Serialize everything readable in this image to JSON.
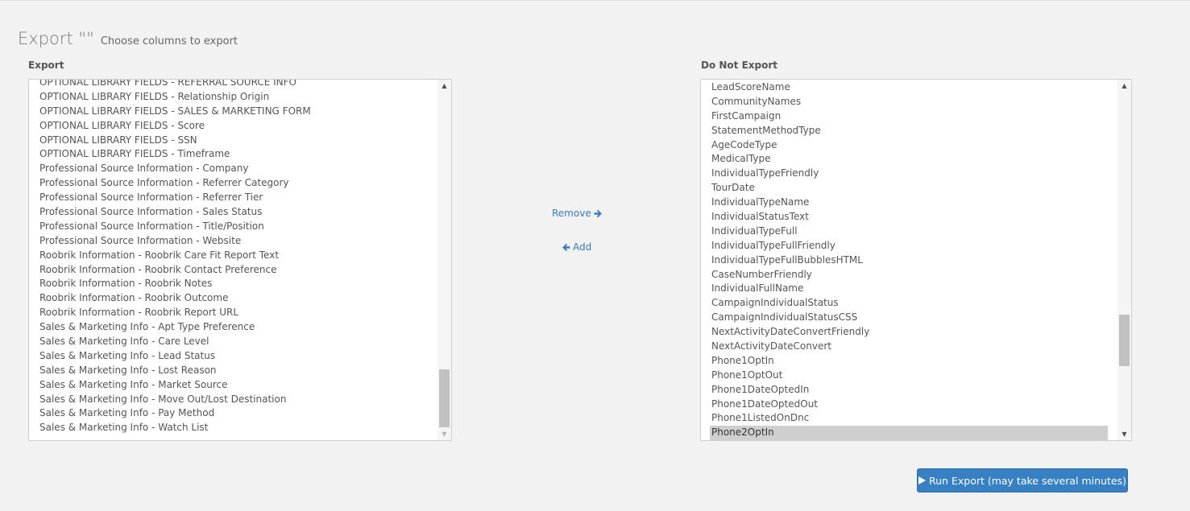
{
  "header": {
    "title": "Export \"\"",
    "subtitle": "Choose columns to export"
  },
  "export_column": {
    "label": "Export",
    "items": [
      "OPTIONAL LIBRARY FIELDS - REFERRAL SOURCE INFO",
      "OPTIONAL LIBRARY FIELDS - Relationship Origin",
      "OPTIONAL LIBRARY FIELDS - SALES & MARKETING FORM",
      "OPTIONAL LIBRARY FIELDS - Score",
      "OPTIONAL LIBRARY FIELDS - SSN",
      "OPTIONAL LIBRARY FIELDS - Timeframe",
      "Professional Source Information - Company",
      "Professional Source Information - Referrer Category",
      "Professional Source Information - Referrer Tier",
      "Professional Source Information - Sales Status",
      "Professional Source Information - Title/Position",
      "Professional Source Information - Website",
      "Roobrik Information - Roobrik Care Fit Report Text",
      "Roobrik Information - Roobrik Contact Preference",
      "Roobrik Information - Roobrik Notes",
      "Roobrik Information - Roobrik Outcome",
      "Roobrik Information - Roobrik Report URL",
      "Sales & Marketing Info - Apt Type Preference",
      "Sales & Marketing Info - Care Level",
      "Sales & Marketing Info - Lead Status",
      "Sales & Marketing Info - Lost Reason",
      "Sales & Marketing Info - Market Source",
      "Sales & Marketing Info - Move Out/Lost Destination",
      "Sales & Marketing Info - Pay Method",
      "Sales & Marketing Info - Watch List"
    ],
    "scroll_position": 1.0
  },
  "do_not_export_column": {
    "label": "Do Not Export",
    "items": [
      "LeadScoreName",
      "CommunityNames",
      "FirstCampaign",
      "StatementMethodType",
      "AgeCodeType",
      "MedicalType",
      "IndividualTypeFriendly",
      "TourDate",
      "IndividualTypeName",
      "IndividualStatusText",
      "IndividualTypeFull",
      "IndividualTypeFullFriendly",
      "IndividualTypeFullBubblesHTML",
      "CaseNumberFriendly",
      "IndividualFullName",
      "CampaignIndividualStatus",
      "CampaignIndividualStatusCSS",
      "NextActivityDateConvertFriendly",
      "NextActivityDateConvert",
      "Phone1OptIn",
      "Phone1OptOut",
      "Phone1DateOptedIn",
      "Phone1DateOptedOut",
      "Phone1ListedOnDnc",
      "Phone2OptIn"
    ],
    "selected_item": "Phone2OptIn",
    "scroll_position": 0.68
  },
  "actions": {
    "remove_label": "Remove",
    "add_label": "Add",
    "run_export_label": "Run Export (may take several minutes)"
  },
  "icons": {
    "remove": "arrow-right-icon",
    "add": "arrow-left-icon",
    "run": "play-icon",
    "scroll_up": "triangle-up-icon",
    "scroll_down": "triangle-down-icon"
  },
  "colors": {
    "link": "#3b7bbf",
    "primary_button": "#3780c3",
    "selected_row": "#cfcfcf",
    "background": "#f2f2f2"
  }
}
